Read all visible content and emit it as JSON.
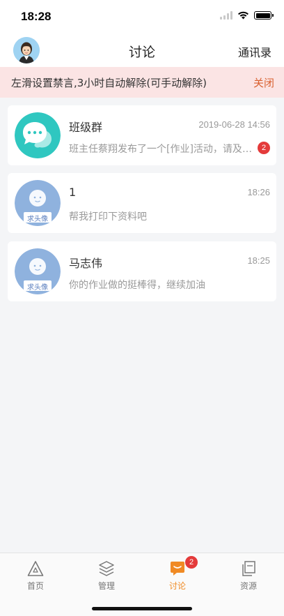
{
  "status_bar": {
    "time": "18:28"
  },
  "header": {
    "title": "讨论",
    "right_label": "通讯录"
  },
  "notice": {
    "text": "左滑设置禁言,3小时自动解除(可手动解除)",
    "close_label": "关闭"
  },
  "conversations": [
    {
      "name": "班级群",
      "time": "2019-06-28 14:56",
      "message": "班主任蔡翔发布了一个[作业]活动，请及时查看",
      "badge": "2",
      "avatar": "chat-bubble-icon"
    },
    {
      "name": "1",
      "time": "18:26",
      "message": "帮我打印下资料吧",
      "avatar_text": "求头像"
    },
    {
      "name": "马志伟",
      "time": "18:25",
      "message": "你的作业做的挺棒得，继续加油",
      "avatar_text": "求头像"
    }
  ],
  "tabs": [
    {
      "label": "首页",
      "icon": "home-triangle-icon"
    },
    {
      "label": "管理",
      "icon": "layers-icon"
    },
    {
      "label": "讨论",
      "icon": "discussion-icon",
      "badge": "2",
      "active": true
    },
    {
      "label": "资源",
      "icon": "resources-icon"
    }
  ],
  "colors": {
    "accent": "#f08a24",
    "badge": "#e43a3a",
    "notice_bg": "#fbe4e4",
    "close": "#d9602f"
  }
}
